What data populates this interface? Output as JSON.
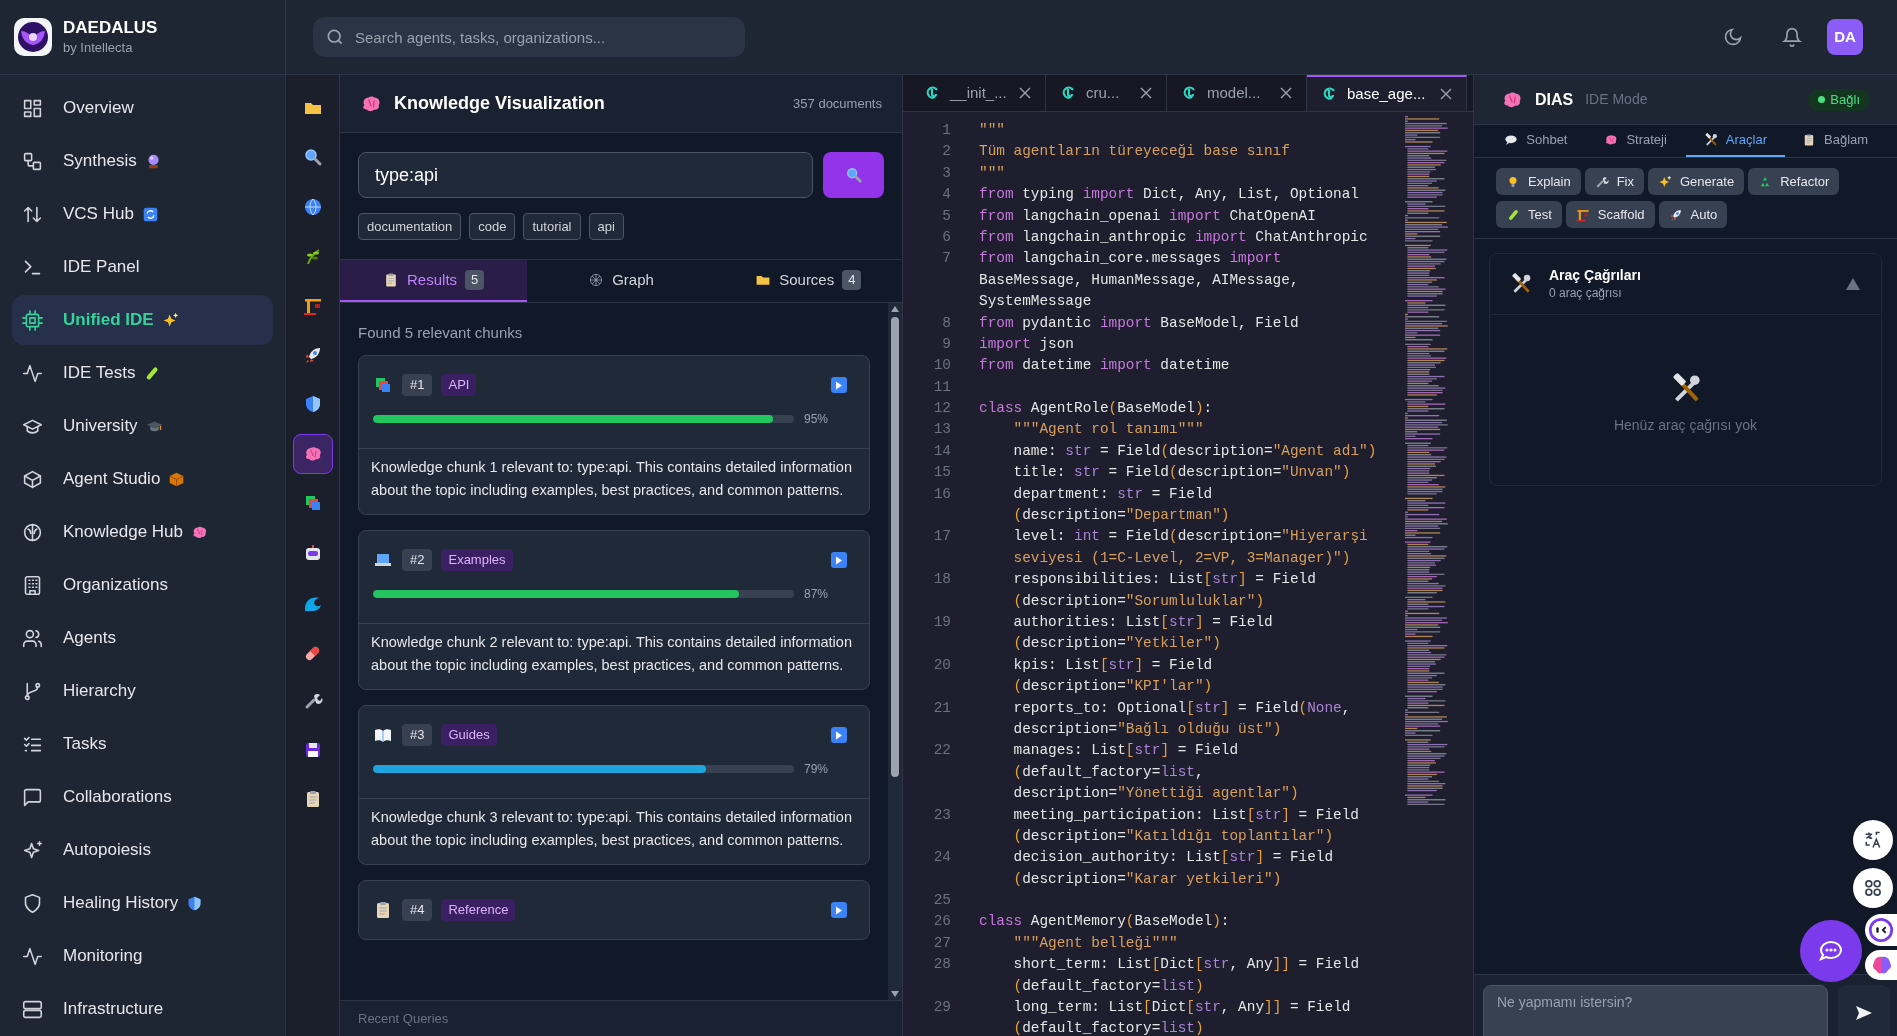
{
  "brand": {
    "name": "DAEDALUS",
    "tagline": "by Intellecta"
  },
  "search": {
    "placeholder": "Search agents, tasks, organizations..."
  },
  "user": {
    "initials": "DA"
  },
  "sidebar": {
    "items": [
      {
        "label": "Overview",
        "selected": false
      },
      {
        "label": "Synthesis",
        "selected": false
      },
      {
        "label": "VCS Hub",
        "selected": false
      },
      {
        "label": "IDE Panel",
        "selected": false
      },
      {
        "label": "Unified IDE",
        "selected": true
      },
      {
        "label": "IDE Tests",
        "selected": false
      },
      {
        "label": "University",
        "selected": false
      },
      {
        "label": "Agent Studio",
        "selected": false
      },
      {
        "label": "Knowledge Hub",
        "selected": false
      },
      {
        "label": "Organizations",
        "selected": false
      },
      {
        "label": "Agents",
        "selected": false
      },
      {
        "label": "Hierarchy",
        "selected": false
      },
      {
        "label": "Tasks",
        "selected": false
      },
      {
        "label": "Collaborations",
        "selected": false
      },
      {
        "label": "Autopoiesis",
        "selected": false
      },
      {
        "label": "Healing History",
        "selected": false
      },
      {
        "label": "Monitoring",
        "selected": false
      },
      {
        "label": "Infrastructure",
        "selected": false
      }
    ]
  },
  "tool_strip": [
    {
      "selected": false
    },
    {
      "selected": false
    },
    {
      "selected": false
    },
    {
      "selected": false
    },
    {
      "selected": false
    },
    {
      "selected": false
    },
    {
      "selected": false
    },
    {
      "selected": true
    },
    {
      "selected": false
    },
    {
      "selected": false
    },
    {
      "selected": false
    },
    {
      "selected": false
    },
    {
      "selected": false
    },
    {
      "selected": false
    },
    {
      "selected": false
    }
  ],
  "knowledge": {
    "title": "Knowledge Visualization",
    "count": "357 documents",
    "query": "type:api",
    "filters": [
      "documentation",
      "code",
      "tutorial",
      "api"
    ],
    "tabs": [
      {
        "label": "Results",
        "count": "5",
        "selected": true
      },
      {
        "label": "Graph",
        "selected": false
      },
      {
        "label": "Sources",
        "count": "4",
        "selected": false
      }
    ],
    "summary": "Found 5 relevant chunks",
    "results": [
      {
        "rank": "#1",
        "tag": "API",
        "level": 0.95,
        "score": "95%",
        "color": "#22c55e",
        "text": "Knowledge chunk 1 relevant to: type:api. This contains detailed information about the topic including examples, best practices, and common patterns."
      },
      {
        "rank": "#2",
        "tag": "Examples",
        "level": 0.87,
        "score": "87%",
        "color": "#22c55e",
        "text": "Knowledge chunk 2 relevant to: type:api. This contains detailed information about the topic including examples, best practices, and common patterns."
      },
      {
        "rank": "#3",
        "tag": "Guides",
        "level": 0.79,
        "score": "79%",
        "color": "#1ea5e0",
        "text": "Knowledge chunk 3 relevant to: type:api. This contains detailed information about the topic including examples, best practices, and common patterns."
      },
      {
        "rank": "#4",
        "tag": "Reference"
      }
    ],
    "footer": "Recent Queries"
  },
  "editor": {
    "tabs": [
      {
        "label": "__init_...",
        "selected": false
      },
      {
        "label": "cru...",
        "selected": false
      },
      {
        "label": "model...",
        "selected": false
      },
      {
        "label": "base_age...",
        "selected": true
      }
    ],
    "lines": [
      {
        "number": "1",
        "rows": [
          "\"\"\""
        ]
      },
      {
        "number": "2",
        "rows": [
          "Tüm agentların türeyeceği base sınıf"
        ]
      },
      {
        "number": "3",
        "rows": [
          "\"\"\""
        ]
      },
      {
        "number": "4",
        "rows": [
          "from typing import Dict, Any, List, Optional"
        ]
      },
      {
        "number": "5",
        "rows": [
          "from langchain_openai import ChatOpenAI"
        ]
      },
      {
        "number": "6",
        "rows": [
          "from langchain_anthropic import ChatAnthropic"
        ]
      },
      {
        "number": "7",
        "rows": [
          "from langchain_core.messages import",
          "BaseMessage, HumanMessage, AIMessage,",
          "SystemMessage"
        ]
      },
      {
        "number": "8",
        "rows": [
          "from pydantic import BaseModel, Field"
        ]
      },
      {
        "number": "9",
        "rows": [
          "import json"
        ]
      },
      {
        "number": "10",
        "rows": [
          "from datetime import datetime"
        ]
      },
      {
        "number": "11"
      },
      {
        "number": "12",
        "rows": [
          "class AgentRole(BaseModel):"
        ]
      },
      {
        "number": "13",
        "rows": [
          "    \"\"\"Agent rol tanımı\"\"\""
        ]
      },
      {
        "number": "14",
        "rows": [
          "    name: str = Field(description=\"Agent adı\")"
        ]
      },
      {
        "number": "15",
        "rows": [
          "    title: str = Field(description=\"Unvan\")"
        ]
      },
      {
        "number": "16",
        "rows": [
          "    department: str = Field",
          "    (description=\"Departman\")"
        ]
      },
      {
        "number": "17",
        "rows": [
          "    level: int = Field(description=\"Hiyerarşi",
          "    seviyesi (1=C-Level, 2=VP, 3=Manager)\")"
        ]
      },
      {
        "number": "18",
        "rows": [
          "    responsibilities: List[str] = Field",
          "    (description=\"Sorumluluklar\")"
        ]
      },
      {
        "number": "19",
        "rows": [
          "    authorities: List[str] = Field",
          "    (description=\"Yetkiler\")"
        ]
      },
      {
        "number": "20",
        "rows": [
          "    kpis: List[str] = Field",
          "    (description=\"KPI'lar\")"
        ]
      },
      {
        "number": "21",
        "rows": [
          "    reports_to: Optional[str] = Field(None,",
          "    description=\"Bağlı olduğu üst\")"
        ]
      },
      {
        "number": "22",
        "rows": [
          "    manages: List[str] = Field",
          "    (default_factory=list,",
          "    description=\"Yönettiği agentlar\")"
        ]
      },
      {
        "number": "23",
        "rows": [
          "    meeting_participation: List[str] = Field",
          "    (description=\"Katıldığı toplantılar\")"
        ]
      },
      {
        "number": "24",
        "rows": [
          "    decision_authority: List[str] = Field",
          "    (description=\"Karar yetkileri\")"
        ]
      },
      {
        "number": "25"
      },
      {
        "number": "26",
        "rows": [
          "class AgentMemory(BaseModel):"
        ]
      },
      {
        "number": "27",
        "rows": [
          "    \"\"\"Agent belleği\"\"\""
        ]
      },
      {
        "number": "28",
        "rows": [
          "    short_term: List[Dict[str, Any]] = Field",
          "    (default_factory=list)"
        ]
      },
      {
        "number": "29",
        "rows": [
          "    long_term: List[Dict[str, Any]] = Field",
          "    (default_factory=list)"
        ]
      }
    ]
  },
  "dias": {
    "title": "DIAS",
    "mode": "IDE Mode",
    "status": "Bağlı",
    "tabs": [
      {
        "label": "Sohbet",
        "selected": false
      },
      {
        "label": "Strateji",
        "selected": false
      },
      {
        "label": "Araçlar",
        "selected": true
      },
      {
        "label": "Bağlam",
        "selected": false
      }
    ],
    "actions": [
      "Explain",
      "Fix",
      "Generate",
      "Refactor",
      "Test",
      "Scaffold",
      "Auto"
    ],
    "tool_calls": {
      "title": "Araç Çağrıları",
      "subtitle": "0 araç çağrısı",
      "expanded": true,
      "empty": "Henüz araç çağrısı yok"
    },
    "input": {
      "placeholder": "Ne yapmamı istersin?"
    }
  }
}
